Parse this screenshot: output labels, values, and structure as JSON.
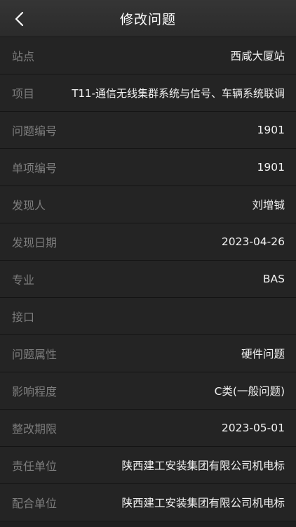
{
  "header": {
    "title": "修改问题"
  },
  "fields": [
    {
      "label": "站点",
      "value": "西咸大厦站"
    },
    {
      "label": "项目",
      "value": "T11-通信无线集群系统与信号、车辆系统联调"
    },
    {
      "label": "问题编号",
      "value": "1901"
    },
    {
      "label": "单项编号",
      "value": "1901"
    },
    {
      "label": "发现人",
      "value": "刘增铖"
    },
    {
      "label": "发现日期",
      "value": "2023-04-26"
    },
    {
      "label": "专业",
      "value": "BAS"
    },
    {
      "label": "接口",
      "value": ""
    },
    {
      "label": "问题属性",
      "value": "硬件问题"
    },
    {
      "label": "影响程度",
      "value": "C类(一般问题)"
    },
    {
      "label": "整改期限",
      "value": "2023-05-01"
    },
    {
      "label": "责任单位",
      "value": "陕西建工安装集团有限公司机电标"
    },
    {
      "label": "配合单位",
      "value": "陕西建工安装集团有限公司机电标"
    }
  ],
  "colors": {
    "background": "#1e1e1e",
    "header": "#303030",
    "label": "#7d7d7d",
    "value": "#f2f2f2"
  }
}
